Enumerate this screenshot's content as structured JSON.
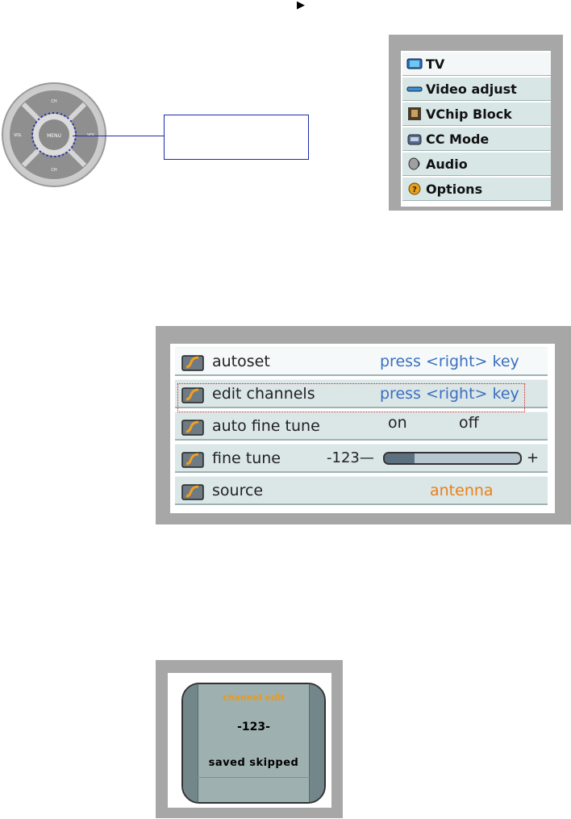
{
  "page": {
    "arrow": "▶"
  },
  "main_menu": {
    "items": [
      {
        "label": "TV",
        "icon": "tv-icon"
      },
      {
        "label": "Video adjust",
        "icon": "video-adjust-icon"
      },
      {
        "label": "VChip Block",
        "icon": "lock-icon"
      },
      {
        "label": "CC Mode",
        "icon": "closed-caption-icon"
      },
      {
        "label": "Audio",
        "icon": "speaker-icon"
      },
      {
        "label": "Options",
        "icon": "options-icon"
      }
    ]
  },
  "setup_menu": {
    "rows": [
      {
        "label": "autoset",
        "value": "press <right> key"
      },
      {
        "label": "edit channels",
        "value": "press <right> key"
      },
      {
        "label": "auto fine tune",
        "option_on": "on",
        "option_off": "off"
      },
      {
        "label": "fine tune",
        "min_label": "-123—",
        "max_label": "+",
        "level": 0.22
      },
      {
        "label": "source",
        "value": "antenna"
      }
    ]
  },
  "channel_edit": {
    "title": "channel edit",
    "number": "-123-",
    "status": "saved skipped"
  },
  "colors": {
    "panel_gray": "#a7a7a7",
    "row_bg": "#dbe6e6",
    "link_blue": "#3b6fc0",
    "value_orange": "#e8801a",
    "callout_blue": "#1a2bb0",
    "highlight_red": "#d02020"
  }
}
